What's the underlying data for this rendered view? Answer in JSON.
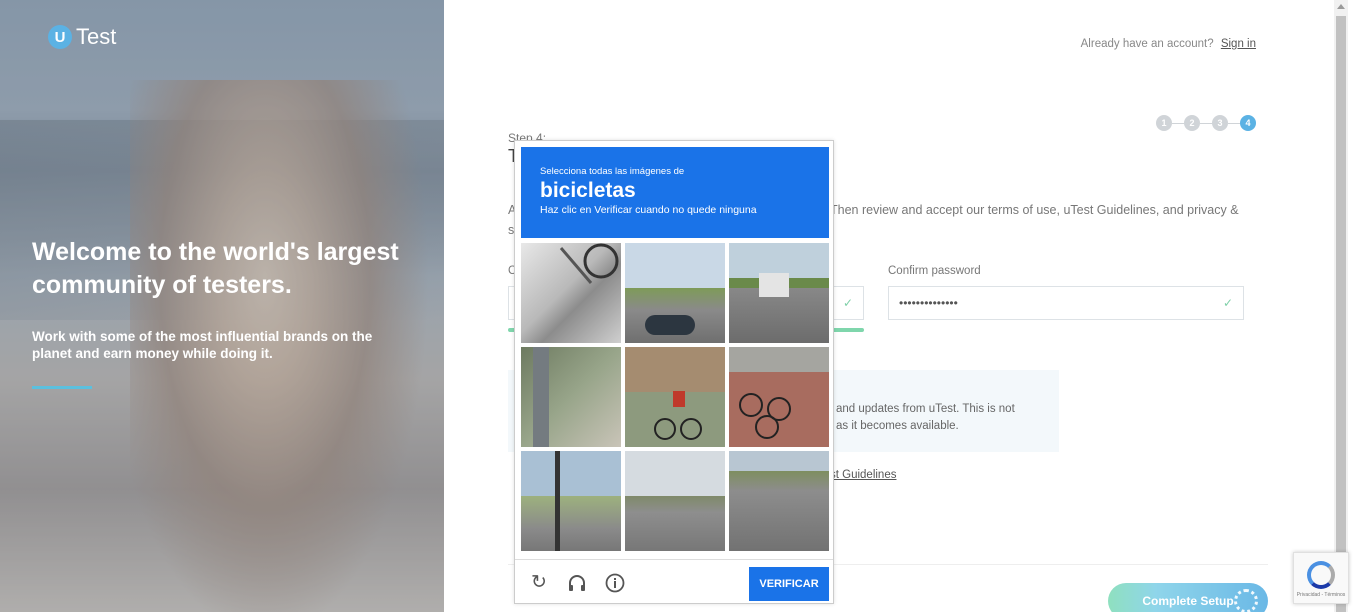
{
  "hero": {
    "logo_letter": "U",
    "logo_text": "Test",
    "headline": "Welcome to the world's largest community of testers.",
    "subtext": "Work with some of the most influential brands on the planet and earn money while doing it."
  },
  "header": {
    "account_prompt": "Already have an account?",
    "sign_in": "Sign in"
  },
  "steps": {
    "items": [
      "1",
      "2",
      "3",
      "4"
    ],
    "active": 4
  },
  "form": {
    "step_label": "Step 4:",
    "step_title": "T",
    "intro_text_left": "A",
    "intro_text_right": "Then review and accept our terms of use, uTest Guidelines, and privacy &",
    "intro_text_line2": "s",
    "password_label": "C",
    "confirm_label": "Confirm password",
    "confirm_value": "••••••••••••••",
    "info_line1": "and updates from uTest. This is not",
    "info_line2": "as it becomes available.",
    "guidelines_link": "st Guidelines",
    "complete_button": "Complete Setup"
  },
  "captcha": {
    "instruction": "Selecciona todas las imágenes de",
    "target": "bicicletas",
    "hint": "Haz clic en Verificar cuando no quede ninguna",
    "verify_button": "VERIFICAR",
    "icons": [
      "reload-icon",
      "headphones-icon",
      "info-icon"
    ]
  },
  "recaptcha_badge": {
    "footer": "Privacidad - Términos"
  },
  "colors": {
    "accent": "#5bb2e4",
    "captcha_blue": "#1a73e8",
    "success": "#7fd6ac"
  }
}
